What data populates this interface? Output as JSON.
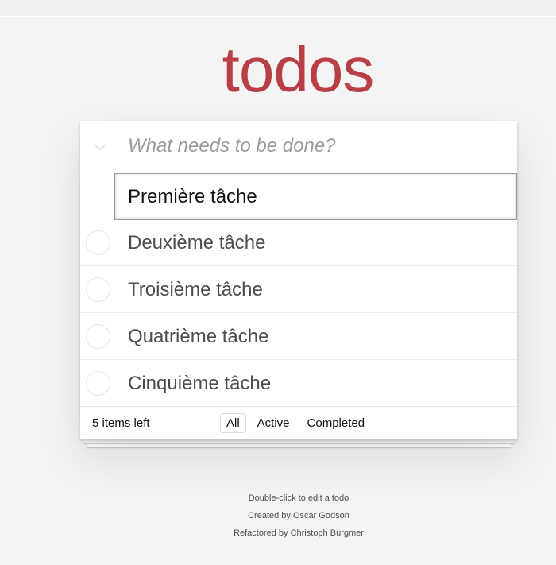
{
  "app": {
    "title": "todos"
  },
  "header": {
    "placeholder": "What needs to be done?",
    "toggle_icon": "chevron-down-icon"
  },
  "editing": {
    "value": "Première tâche"
  },
  "todos": [
    {
      "label": "Deuxième tâche",
      "completed": false
    },
    {
      "label": "Troisième tâche",
      "completed": false
    },
    {
      "label": "Quatrième tâche",
      "completed": false
    },
    {
      "label": "Cinquième tâche",
      "completed": false
    }
  ],
  "footer": {
    "count": "5 items left",
    "filters": [
      {
        "label": "All",
        "selected": true
      },
      {
        "label": "Active",
        "selected": false
      },
      {
        "label": "Completed",
        "selected": false
      }
    ]
  },
  "info": [
    "Double-click to edit a todo",
    "Created by Oscar Godson",
    "Refactored by Christoph Burgmer"
  ],
  "colors": {
    "title": "#b83f45",
    "background": "#f4f4f4"
  }
}
